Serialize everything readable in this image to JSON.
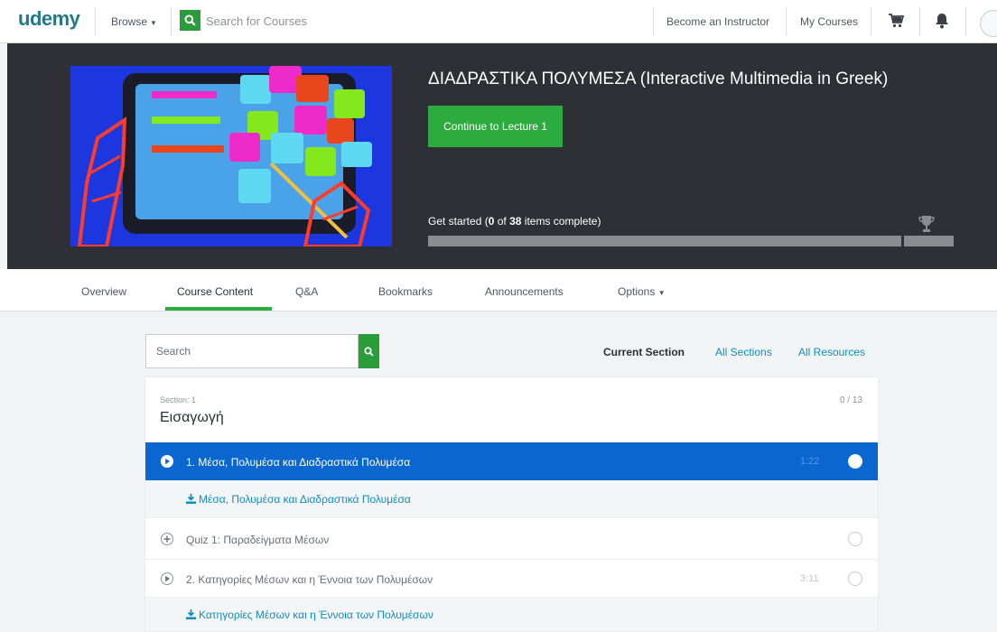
{
  "header": {
    "logo": "udemy",
    "browse_label": "Browse",
    "search_placeholder": "Search for Courses",
    "become_instructor": "Become an Instructor",
    "my_courses": "My Courses"
  },
  "hero": {
    "course_title": "ΔΙΑΔΡΑΣΤΙΚΑ ΠΟΛΥΜΕΣΑ (Interactive Multimedia in Greek)",
    "continue_button": "Continue to Lecture 1",
    "progress_prefix": "Get started (",
    "completed_count": "0",
    "progress_of": " of ",
    "total_items": "38",
    "progress_suffix": " items complete)",
    "progress_fraction": 0
  },
  "tabs": [
    {
      "label": "Overview"
    },
    {
      "label": "Course Content",
      "active": true
    },
    {
      "label": "Q&A"
    },
    {
      "label": "Bookmarks"
    },
    {
      "label": "Announcements"
    },
    {
      "label": "Options"
    }
  ],
  "content": {
    "search_placeholder": "Search",
    "filters": {
      "current_section": "Current Section",
      "all_sections": "All Sections",
      "all_resources": "All Resources"
    },
    "section": {
      "label": "Section: 1",
      "title": "Εισαγωγή",
      "progress": "0 / 13"
    },
    "items": [
      {
        "type": "lecture",
        "state": "active",
        "label": "1.  Μέσα, Πολυμέσα και Διαδραστικά Πολυμέσα",
        "duration": "1:22"
      },
      {
        "type": "resource",
        "label": "Μέσα, Πολυμέσα και Διαδραστικά Πολυμέσα"
      },
      {
        "type": "quiz",
        "state": "normal",
        "label": "Quiz 1:  Παραδείγματα Μέσων",
        "duration": ""
      },
      {
        "type": "lecture",
        "state": "normal",
        "label": "2.  Κατηγορίες Μέσων και η Έννοια των Πολυμέσων",
        "duration": "3:11"
      },
      {
        "type": "resource",
        "label": "Κατηγορίες Μέσων και η Έννοια των Πολυμέσων"
      }
    ]
  },
  "colors": {
    "brand_green": "#2cab3e",
    "active_blue": "#0b67d0",
    "link_blue": "#0d8fbd",
    "hero_bg": "#2f3035"
  }
}
